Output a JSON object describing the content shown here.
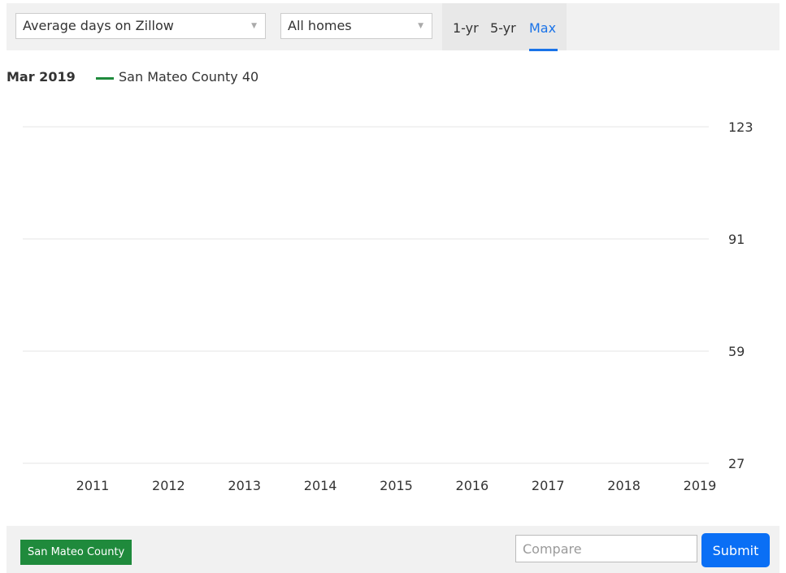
{
  "controls": {
    "metric": "Average days on Zillow",
    "home_type": "All homes",
    "tabs": [
      "1-yr",
      "5-yr",
      "Max"
    ],
    "active_tab": "Max"
  },
  "legend": {
    "date": "Mar 2019",
    "series_label": "San Mateo County 40"
  },
  "chart_data": {
    "type": "line",
    "xlabel": "",
    "ylabel": "",
    "x_ticks": [
      "2011",
      "2012",
      "2013",
      "2014",
      "2015",
      "2016",
      "2017",
      "2018",
      "2019"
    ],
    "y_ticks": [
      27,
      59,
      91,
      123
    ],
    "ylim": [
      27,
      123
    ],
    "grid": true,
    "series": [
      {
        "name": "San Mateo County",
        "color": "#1f8a3c",
        "values": []
      }
    ]
  },
  "footer": {
    "region": "San Mateo County",
    "compare_placeholder": "Compare",
    "submit_label": "Submit"
  },
  "colors": {
    "accent": "#1a73e8",
    "series_green": "#1f8a3c",
    "submit_blue": "#0a6ff5"
  }
}
